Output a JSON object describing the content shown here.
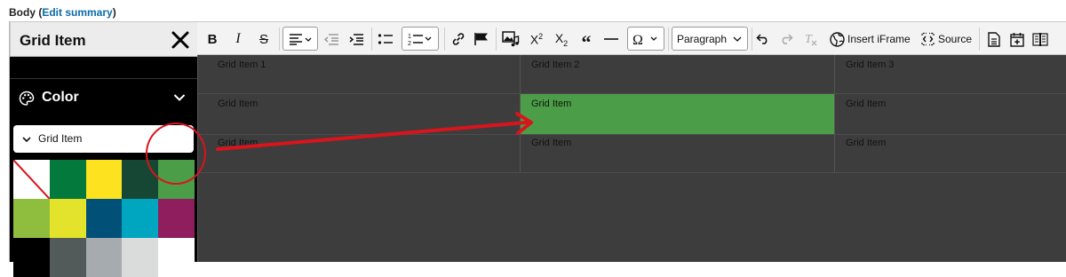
{
  "field": {
    "label": "Body",
    "link": "Edit summary"
  },
  "panel": {
    "title": "Grid Item",
    "section_label": "Color",
    "select_label": "Grid Item",
    "swatches": [
      {
        "name": "no-color-swatch",
        "color": "#ffffff"
      },
      {
        "name": "dark-green-swatch",
        "color": "#037a3c"
      },
      {
        "name": "yellow-swatch",
        "color": "#fde21f"
      },
      {
        "name": "forest-green-swatch",
        "color": "#154734"
      },
      {
        "name": "green-swatch",
        "color": "#4b9e47"
      },
      {
        "name": "lime-green-swatch",
        "color": "#8fbe3f"
      },
      {
        "name": "chartreuse-swatch",
        "color": "#e2e32a"
      },
      {
        "name": "navy-blue-swatch",
        "color": "#005078"
      },
      {
        "name": "teal-swatch",
        "color": "#00a6bf"
      },
      {
        "name": "magenta-swatch",
        "color": "#8f1e5e"
      },
      {
        "name": "black-swatch",
        "color": "#000000"
      },
      {
        "name": "charcoal-swatch",
        "color": "#525a5a"
      },
      {
        "name": "gray-swatch",
        "color": "#a5abae"
      },
      {
        "name": "light-gray-swatch",
        "color": "#d9dcdb"
      },
      {
        "name": "white-swatch",
        "color": "#ffffff"
      }
    ]
  },
  "toolbar": {
    "paragraph": "Paragraph",
    "insert_iframe": "Insert iFrame",
    "source": "Source"
  },
  "grid": {
    "headers": [
      "Grid Item 1",
      "Grid Item 2",
      "Grid Item 3"
    ],
    "rows": [
      [
        "Grid Item",
        "Grid Item",
        "Grid Item"
      ],
      [
        "Grid Item",
        "Grid Item",
        "Grid Item"
      ]
    ],
    "selected_cell_color": "#4b9e47"
  },
  "annotation_color": "#d9141c"
}
